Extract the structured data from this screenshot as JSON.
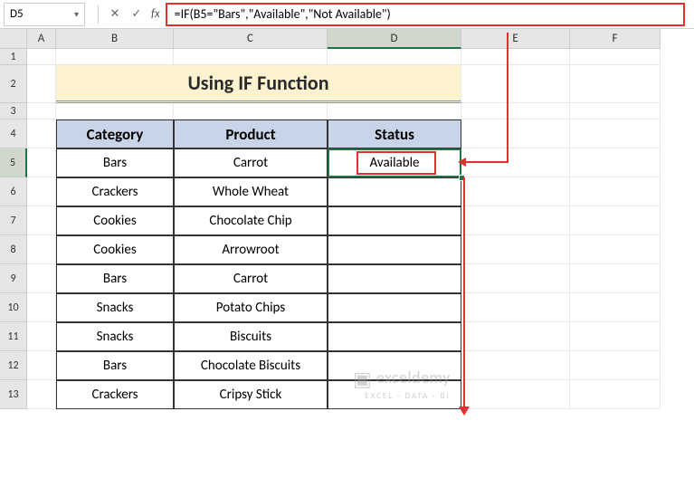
{
  "nameBox": "D5",
  "formula": "=IF(B5=\"Bars\",\"Available\",\"Not Available\")",
  "columns": [
    "A",
    "B",
    "C",
    "D",
    "E",
    "F"
  ],
  "rowNumbers": [
    "1",
    "2",
    "3",
    "4",
    "5",
    "6",
    "7",
    "8",
    "9",
    "10",
    "11",
    "12",
    "13"
  ],
  "title": "Using IF Function",
  "headers": {
    "category": "Category",
    "product": "Product",
    "status": "Status"
  },
  "rows": [
    {
      "category": "Bars",
      "product": "Carrot",
      "status": "Available"
    },
    {
      "category": "Crackers",
      "product": "Whole Wheat",
      "status": ""
    },
    {
      "category": "Cookies",
      "product": "Chocolate Chip",
      "status": ""
    },
    {
      "category": "Cookies",
      "product": "Arrowroot",
      "status": ""
    },
    {
      "category": "Bars",
      "product": "Carrot",
      "status": ""
    },
    {
      "category": "Snacks",
      "product": "Potato Chips",
      "status": ""
    },
    {
      "category": "Snacks",
      "product": "Biscuits",
      "status": ""
    },
    {
      "category": "Bars",
      "product": "Chocolate Biscuits",
      "status": ""
    },
    {
      "category": "Crackers",
      "product": "Cripsy Stick",
      "status": ""
    }
  ],
  "watermark": {
    "main": "exceldemy",
    "sub": "EXCEL · DATA · BI"
  },
  "icons": {
    "dropdown": "▾",
    "cancel": "✕",
    "confirm": "✓",
    "fx": "fx"
  },
  "chart_data": {
    "type": "table",
    "title": "Using IF Function",
    "columns": [
      "Category",
      "Product",
      "Status"
    ],
    "rows": [
      [
        "Bars",
        "Carrot",
        "Available"
      ],
      [
        "Crackers",
        "Whole Wheat",
        ""
      ],
      [
        "Cookies",
        "Chocolate Chip",
        ""
      ],
      [
        "Cookies",
        "Arrowroot",
        ""
      ],
      [
        "Bars",
        "Carrot",
        ""
      ],
      [
        "Snacks",
        "Potato Chips",
        ""
      ],
      [
        "Snacks",
        "Biscuits",
        ""
      ],
      [
        "Bars",
        "Chocolate Biscuits",
        ""
      ],
      [
        "Crackers",
        "Cripsy Stick",
        ""
      ]
    ]
  }
}
